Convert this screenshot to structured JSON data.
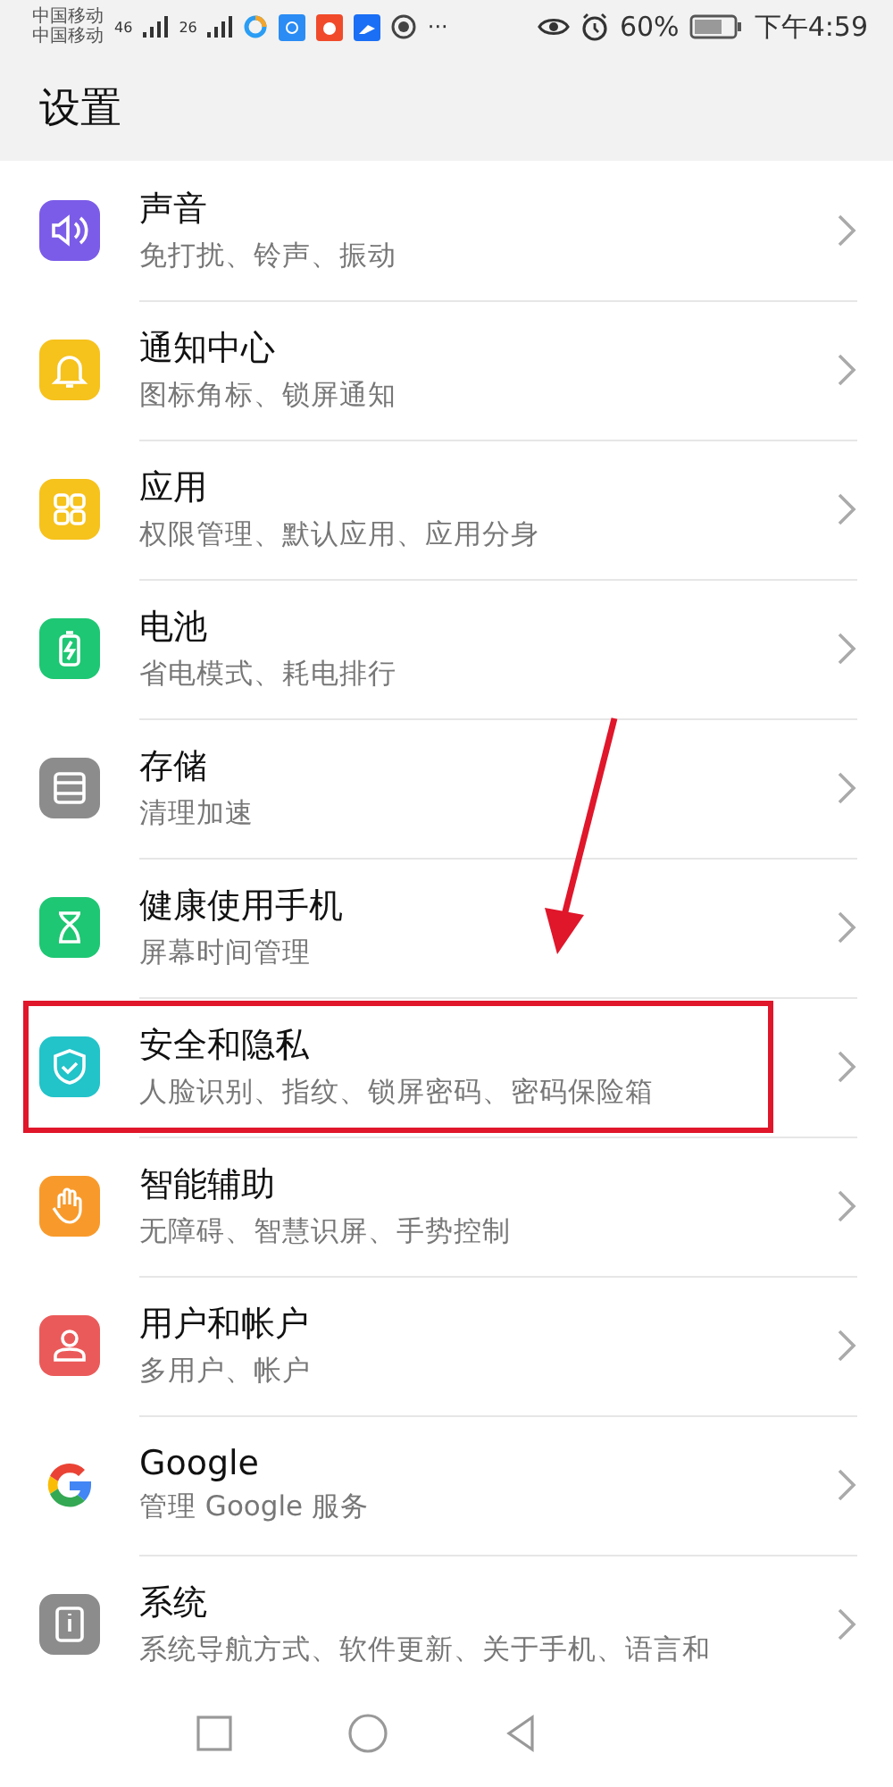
{
  "status_bar": {
    "carriers": [
      "中国移动",
      "中国移动"
    ],
    "network_labels": [
      "46",
      "26"
    ],
    "more": "···",
    "battery": "60%",
    "time": "下午4:59"
  },
  "header": {
    "title": "设置"
  },
  "items": [
    {
      "title": "声音",
      "subtitle": "免打扰、铃声、振动",
      "color": "#7b5ce8",
      "highlighted": false
    },
    {
      "title": "通知中心",
      "subtitle": "图标角标、锁屏通知",
      "color": "#f6c21c",
      "highlighted": false
    },
    {
      "title": "应用",
      "subtitle": "权限管理、默认应用、应用分身",
      "color": "#f6c21c",
      "highlighted": false
    },
    {
      "title": "电池",
      "subtitle": "省电模式、耗电排行",
      "color": "#1ec773",
      "highlighted": false
    },
    {
      "title": "存储",
      "subtitle": "清理加速",
      "color": "#8c8c8c",
      "highlighted": false
    },
    {
      "title": "健康使用手机",
      "subtitle": "屏幕时间管理",
      "color": "#1ec773",
      "highlighted": false
    },
    {
      "title": "安全和隐私",
      "subtitle": "人脸识别、指纹、锁屏密码、密码保险箱",
      "color": "#22c3c9",
      "highlighted": true
    },
    {
      "title": "智能辅助",
      "subtitle": "无障碍、智慧识屏、手势控制",
      "color": "#f89a2b",
      "highlighted": false
    },
    {
      "title": "用户和帐户",
      "subtitle": "多用户、帐户",
      "color": "#eb5a5a",
      "highlighted": false
    },
    {
      "title": "Google",
      "subtitle": "管理 Google 服务",
      "color": "#ffffff",
      "highlighted": false
    },
    {
      "title": "系统",
      "subtitle": "系统导航方式、软件更新、关于手机、语言和",
      "color": "#8c8c8c",
      "highlighted": false
    }
  ]
}
